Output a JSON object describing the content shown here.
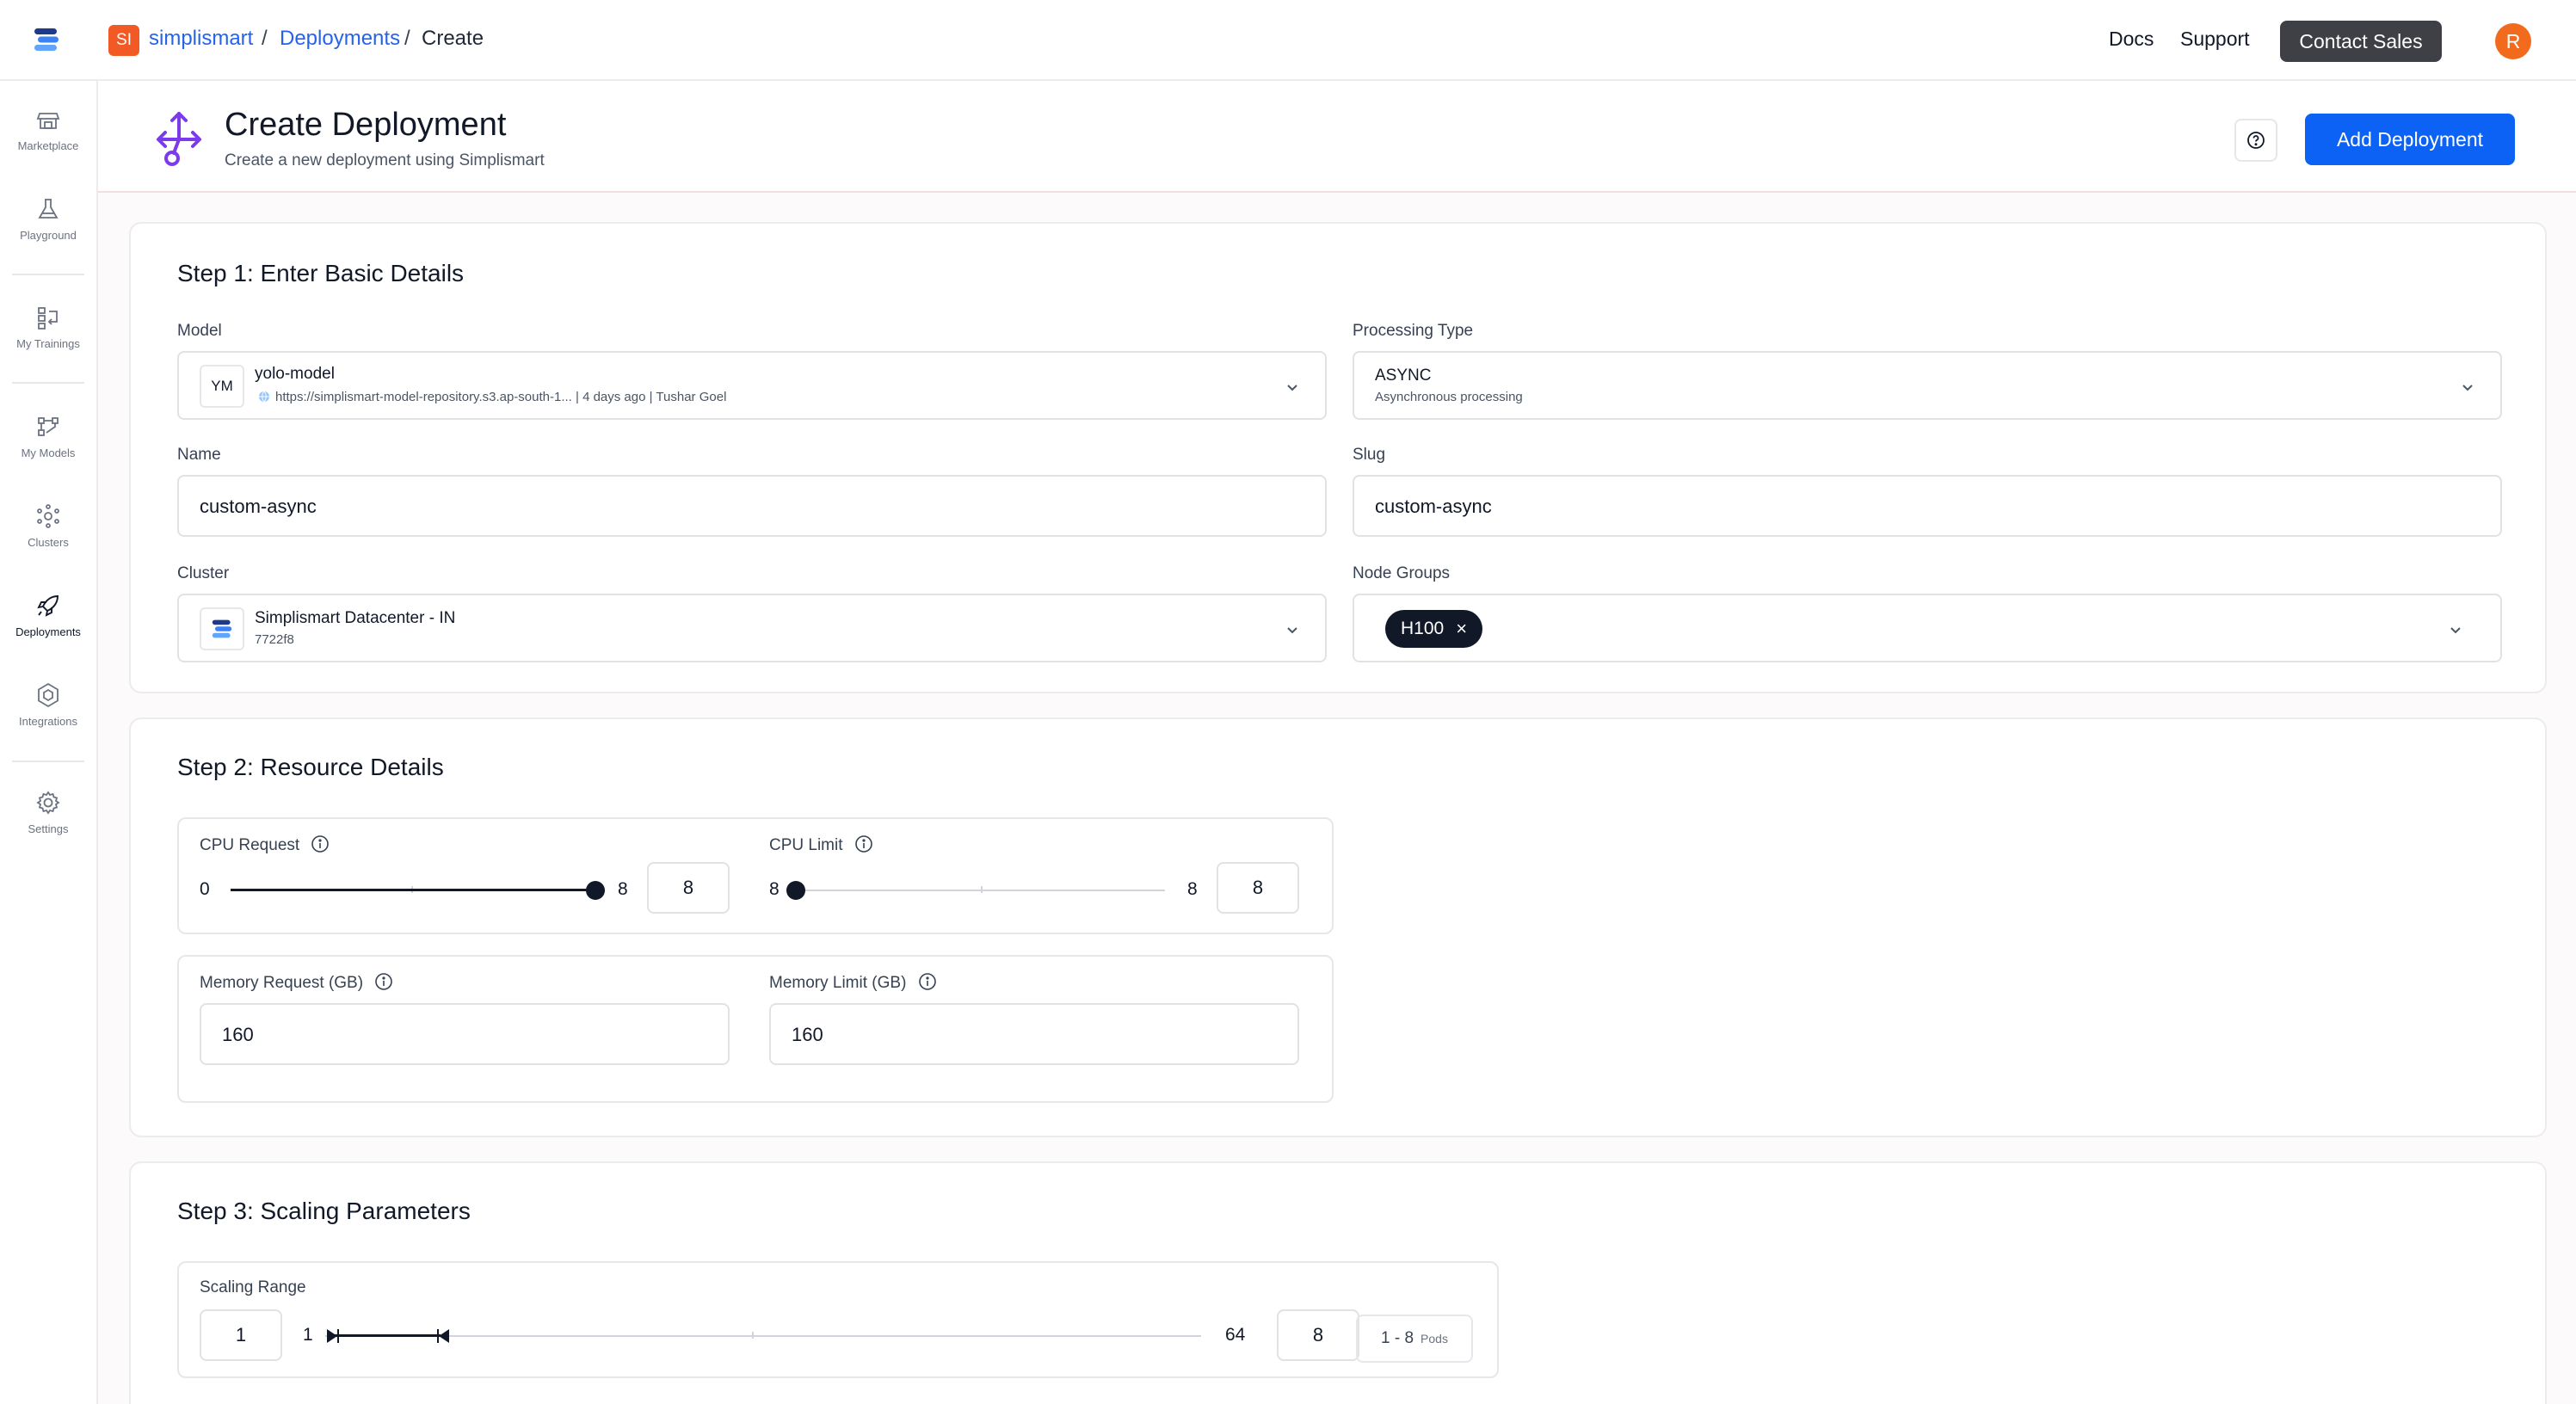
{
  "topbar": {
    "org_initials": "SI",
    "breadcrumb": [
      "simplismart",
      "/",
      "Deployments",
      "/",
      "Create"
    ],
    "docs": "Docs",
    "support": "Support",
    "contact_sales": "Contact Sales",
    "avatar_initial": "R"
  },
  "sidebar": {
    "items": [
      {
        "label": "Marketplace",
        "icon": "store-icon"
      },
      {
        "label": "Playground",
        "icon": "flask-icon"
      },
      {
        "label": "My Trainings",
        "icon": "trainings-icon"
      },
      {
        "label": "My Models",
        "icon": "models-icon"
      },
      {
        "label": "Clusters",
        "icon": "clusters-icon"
      },
      {
        "label": "Deployments",
        "icon": "rocket-icon",
        "active": true
      },
      {
        "label": "Integrations",
        "icon": "integrations-icon"
      },
      {
        "label": "Settings",
        "icon": "gear-icon"
      }
    ]
  },
  "header": {
    "title": "Create Deployment",
    "subtitle": "Create a new deployment using Simplismart",
    "add_button": "Add Deployment"
  },
  "step1": {
    "title": "Step 1: Enter Basic Details",
    "model": {
      "label": "Model",
      "avatar": "YM",
      "name": "yolo-model",
      "meta": "https://simplismart-model-repository.s3.ap-south-1... | 4 days ago | Tushar Goel"
    },
    "processing_type": {
      "label": "Processing Type",
      "value": "ASYNC",
      "description": "Asynchronous processing"
    },
    "name": {
      "label": "Name",
      "value": "custom-async"
    },
    "slug": {
      "label": "Slug",
      "value": "custom-async"
    },
    "cluster": {
      "label": "Cluster",
      "name": "Simplismart Datacenter - IN",
      "id": "7722f8"
    },
    "node_groups": {
      "label": "Node Groups",
      "chips": [
        "H100"
      ],
      "chip_remove": "×"
    }
  },
  "step2": {
    "title": "Step 2: Resource Details",
    "cpu_request": {
      "label": "CPU Request",
      "min": "0",
      "max": "8",
      "value": "8"
    },
    "cpu_limit": {
      "label": "CPU Limit",
      "min": "8",
      "max": "8",
      "value": "8"
    },
    "memory_request": {
      "label": "Memory Request (GB)",
      "value": "160"
    },
    "memory_limit": {
      "label": "Memory Limit (GB)",
      "value": "160"
    }
  },
  "step3": {
    "title": "Step 3: Scaling Parameters",
    "scaling_range": {
      "label": "Scaling Range",
      "min_value": "1",
      "min": "1",
      "max": "64",
      "max_value": "8",
      "summary": "1 - 8",
      "summary_unit": "Pods"
    }
  },
  "colors": {
    "primary_button": "#0b62f5",
    "org_badge": "#f15a24",
    "avatar": "#f26b1d",
    "contact_button": "#3f3f46",
    "header_icon": "#7c3aed",
    "link": "#2563eb"
  }
}
